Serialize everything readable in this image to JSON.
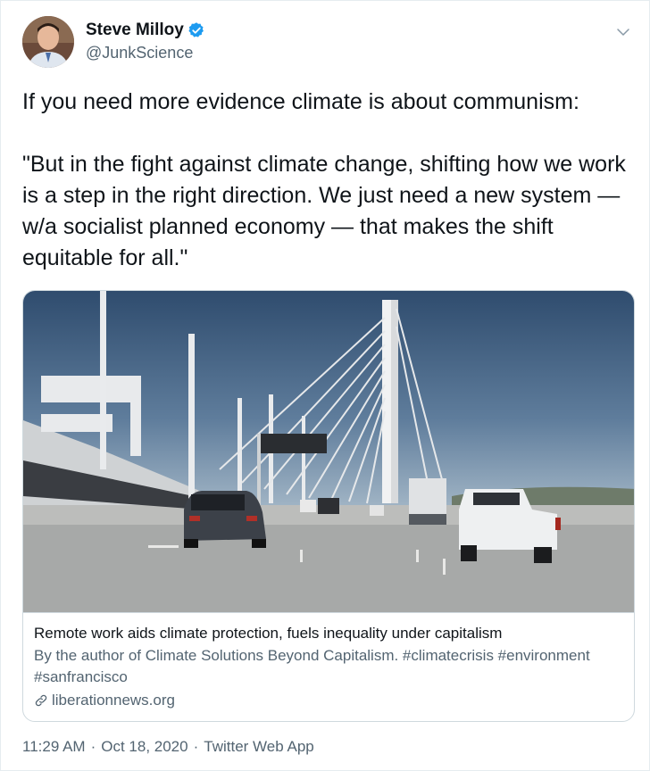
{
  "user": {
    "display_name": "Steve Milloy",
    "handle": "@JunkScience",
    "verified": true
  },
  "tweet": {
    "text": "If you need more evidence climate is about communism:\n\n\"But in the fight against climate change, shifting how we work is a step in the right direction. We just need a new system — w/a socialist planned economy — that makes the shift equitable for all.\""
  },
  "card": {
    "title": "Remote work aids climate protection, fuels inequality under capitalism",
    "description": "By the author of Climate Solutions Beyond Capitalism. #climatecrisis #environment #sanfrancisco",
    "domain": "liberationnews.org",
    "image_icon": "bridge-highway-photo"
  },
  "meta": {
    "time": "11:29 AM",
    "date": "Oct 18, 2020",
    "source": "Twitter Web App",
    "separator": "·"
  },
  "colors": {
    "text_primary": "#0f1419",
    "text_secondary": "#536471",
    "verified_blue": "#1d9bf0",
    "border": "#cfd9de"
  }
}
